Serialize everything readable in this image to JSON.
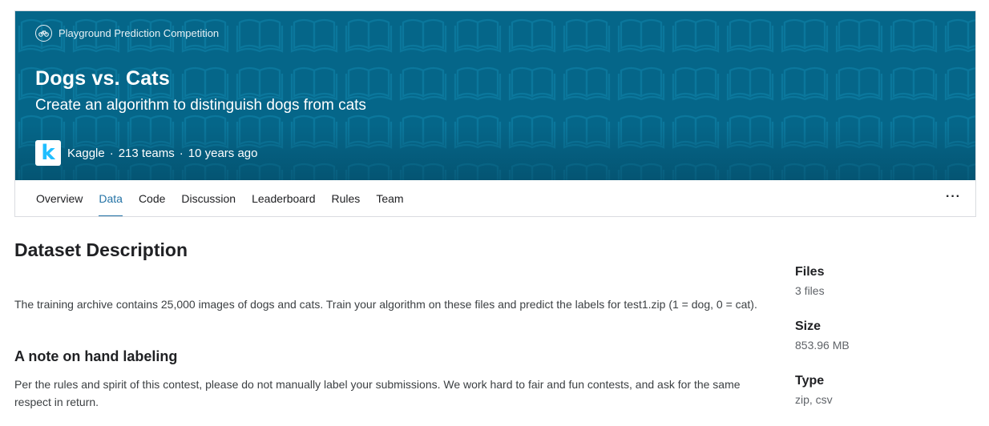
{
  "header": {
    "competition_type": "Playground Prediction Competition",
    "title": "Dogs vs. Cats",
    "subtitle": "Create an algorithm to distinguish dogs from cats",
    "host": "Kaggle",
    "teams": "213 teams",
    "age": "10 years ago",
    "separator": "·",
    "host_logo_letter": "k"
  },
  "tabs": [
    {
      "label": "Overview"
    },
    {
      "label": "Data",
      "active": true
    },
    {
      "label": "Code"
    },
    {
      "label": "Discussion"
    },
    {
      "label": "Leaderboard"
    },
    {
      "label": "Rules"
    },
    {
      "label": "Team"
    }
  ],
  "more_label": "···",
  "content": {
    "heading": "Dataset Description",
    "paragraph1": "The training archive contains 25,000 images of dogs and cats. Train your algorithm on these files and predict the labels for test1.zip (1 = dog, 0 = cat).",
    "subheading": "A note on hand labeling",
    "paragraph2": "Per the rules and spirit of this contest, please do not manually label your submissions. We work hard to fair and fun contests, and ask for the same respect in return."
  },
  "sidebar": {
    "files_label": "Files",
    "files_value": "3 files",
    "size_label": "Size",
    "size_value": "853.96 MB",
    "type_label": "Type",
    "type_value": "zip, csv"
  },
  "colors": {
    "banner": "#056689",
    "accent": "#2473a6",
    "kaggle_blue": "#20beff"
  },
  "icons": {
    "competition_type": "bicycle-icon",
    "pattern": "open-book-icon"
  }
}
